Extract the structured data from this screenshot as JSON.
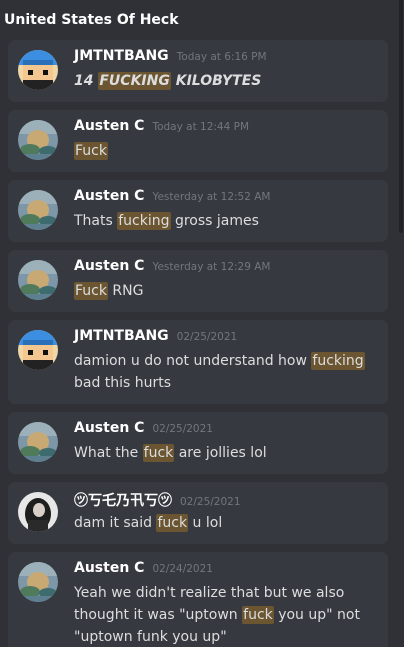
{
  "channel": {
    "title": "United States Of Heck"
  },
  "messages": [
    {
      "author": "JMTNTBANG",
      "timestamp": "Today at 6:16 PM",
      "avatar": "blue-cap-pixel-avatar",
      "style": "bolditalic",
      "parts": [
        {
          "text": "14 "
        },
        {
          "text": "FUCKING",
          "hl": true
        },
        {
          "text": " KILOBYTES"
        }
      ]
    },
    {
      "author": "Austen C",
      "timestamp": "Today at 12:44 PM",
      "avatar": "painting-avatar",
      "parts": [
        {
          "text": "Fuck",
          "hl": true
        }
      ]
    },
    {
      "author": "Austen C",
      "timestamp": "Yesterday at 12:52 AM",
      "avatar": "painting-avatar",
      "parts": [
        {
          "text": "Thats "
        },
        {
          "text": "fucking",
          "hl": true
        },
        {
          "text": " gross james"
        }
      ]
    },
    {
      "author": "Austen C",
      "timestamp": "Yesterday at 12:29 AM",
      "avatar": "painting-avatar",
      "parts": [
        {
          "text": "Fuck",
          "hl": true
        },
        {
          "text": " RNG"
        }
      ]
    },
    {
      "author": "JMTNTBANG",
      "timestamp": "02/25/2021",
      "avatar": "blue-cap-pixel-avatar",
      "parts": [
        {
          "text": "damion u do not understand how "
        },
        {
          "text": "fucking",
          "hl": true
        },
        {
          "text": " bad this hurts"
        }
      ]
    },
    {
      "author": "Austen C",
      "timestamp": "02/25/2021",
      "avatar": "painting-avatar",
      "parts": [
        {
          "text": "What the "
        },
        {
          "text": "fuck",
          "hl": true
        },
        {
          "text": " are jollies lol"
        }
      ]
    },
    {
      "author": "㋡丂乇乃卂丂㋡",
      "timestamp": "02/25/2021",
      "avatar": "dark-photo-avatar",
      "parts": [
        {
          "text": "dam it said "
        },
        {
          "text": "fuck",
          "hl": true
        },
        {
          "text": " u lol"
        }
      ]
    },
    {
      "author": "Austen C",
      "timestamp": "02/24/2021",
      "avatar": "painting-avatar",
      "parts": [
        {
          "text": "Yeah we didn't realize that but we also thought it was \"uptown "
        },
        {
          "text": "fuck",
          "hl": true
        },
        {
          "text": " you up\" not \"uptown funk you up\""
        }
      ]
    }
  ],
  "colors": {
    "background": "#2f3136",
    "card": "#36393f",
    "highlight": "#6b5631",
    "timestamp": "#72767d"
  }
}
